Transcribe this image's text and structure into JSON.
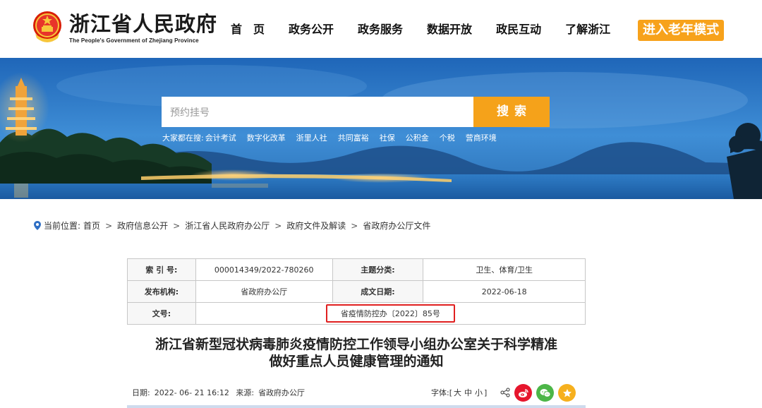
{
  "header": {
    "logo_cn": "浙江省人民政府",
    "logo_en": "The People's Government of Zhejiang Province",
    "nav": [
      "首页",
      "政务公开",
      "政务服务",
      "数据开放",
      "政民互动",
      "了解浙江"
    ],
    "elder_mode": "进入老年模式"
  },
  "search": {
    "placeholder": "预约挂号",
    "button": "搜索",
    "hot_label": "大家都在搜:",
    "hot_items": [
      "会计考试",
      "数字化改革",
      "浙里人社",
      "共同富裕",
      "社保",
      "公积金",
      "个税",
      "营商环境"
    ]
  },
  "breadcrumb": {
    "label": "当前位置:",
    "items": [
      "首页",
      "政府信息公开",
      "浙江省人民政府办公厅",
      "政府文件及解读",
      "省政府办公厅文件"
    ]
  },
  "info": {
    "index_label": "索 引 号:",
    "index_value": "000014349/2022-780260",
    "subject_label": "主题分类:",
    "subject_value": "卫生、体育/卫生",
    "issuer_label": "发布机构:",
    "issuer_value": "省政府办公厅",
    "date_label": "成文日期:",
    "date_value": "2022-06-18",
    "docno_label": "文号:",
    "docno_value": "省疫情防控办〔2022〕85号"
  },
  "article": {
    "title_line1": "浙江省新型冠状病毒肺炎疫情防控工作领导小组办公室关于科学精准",
    "title_line2": "做好重点人员健康管理的通知",
    "date_label": "日期:",
    "date_value": "2022- 06- 21 16:12",
    "source_label": "来源:",
    "source_value": "省政府办公厅",
    "fontsize_label": "字体:",
    "fontsize_open": "[",
    "fontsize_options": [
      "大",
      "中",
      "小"
    ],
    "fontsize_close": "]"
  },
  "icons": {
    "share": "share-icon",
    "weibo": "weibo-icon",
    "wechat": "wechat-icon",
    "favorite": "star-icon"
  },
  "colors": {
    "accent": "#f5a21a",
    "highlight_box": "#e02020",
    "weibo": "#e6162d",
    "wechat": "#4cb648",
    "favorite": "#f6b01e"
  }
}
